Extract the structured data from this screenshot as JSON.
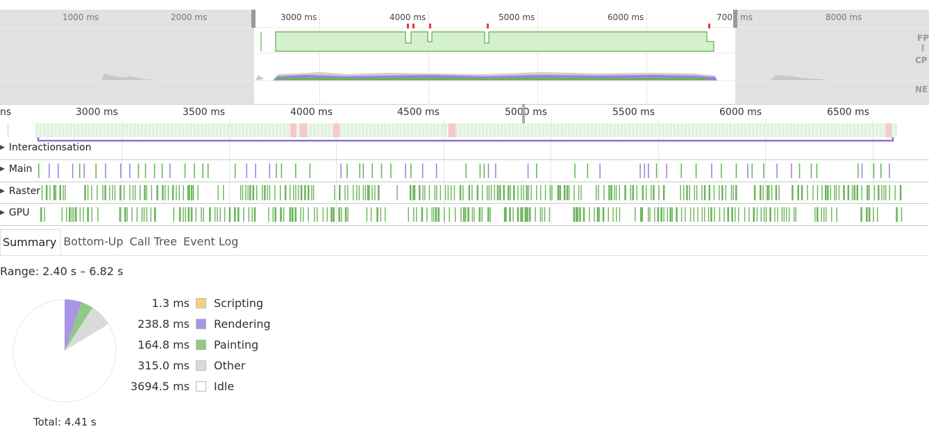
{
  "overview": {
    "ticks": [
      "1000 ms",
      "2000 ms",
      "3000 ms",
      "4000 ms",
      "5000 ms",
      "6000 ms",
      "700",
      "ms",
      "8000 ms"
    ],
    "track_labels": [
      "FP",
      "CP",
      "NE"
    ]
  },
  "flame": {
    "ticks": [
      "ns",
      "3000 ms",
      "3500 ms",
      "4000 ms",
      "4500 ms",
      "5000 ms",
      "5500 ms",
      "6000 ms",
      "6500 ms"
    ],
    "tracks": [
      {
        "label": "Interactionsation"
      },
      {
        "label": "Main"
      },
      {
        "label": "Raster"
      },
      {
        "label": "GPU"
      }
    ]
  },
  "tabs": [
    "Summary",
    "Bottom-Up",
    "Call Tree",
    "Event Log"
  ],
  "summary": {
    "range": "Range: 2.40 s – 6.82 s",
    "total": "Total: 4.41 s",
    "items": [
      {
        "value": "1.3 ms",
        "name": "Scripting",
        "color": "#f2d27a"
      },
      {
        "value": "238.8 ms",
        "name": "Rendering",
        "color": "#a994e6"
      },
      {
        "value": "164.8 ms",
        "name": "Painting",
        "color": "#8fc983"
      },
      {
        "value": "315.0 ms",
        "name": "Other",
        "color": "#dadada"
      },
      {
        "value": "3694.5 ms",
        "name": "Idle",
        "color": "#ffffff"
      }
    ]
  },
  "colors": {
    "fps_green": "#d5f0cf",
    "fps_line": "#56b13f",
    "rendering": "#9b85dc",
    "painting": "#6ab45a",
    "frame_light": "#e0f2dc",
    "frame_red": "#f7c7cb",
    "marker_red": "#e53935"
  }
}
